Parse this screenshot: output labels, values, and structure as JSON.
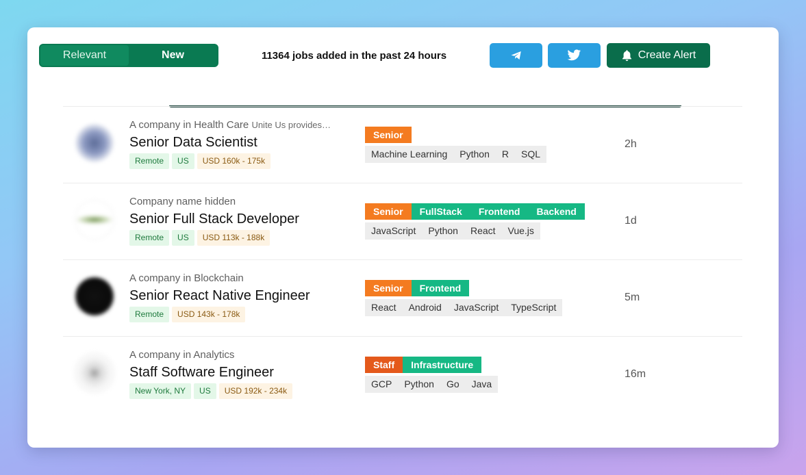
{
  "toolbar": {
    "sort_options": [
      "Relevant",
      "New"
    ],
    "active_sort": "Relevant",
    "headline": "11364 jobs added in the past 24 hours",
    "telegram_icon": "telegram-icon",
    "twitter_icon": "twitter-icon",
    "create_alert_label": "Create Alert"
  },
  "colors": {
    "primary_green": "#0a7a52",
    "social_blue": "#2a9fe0",
    "label_orange": "#f47b20",
    "label_teal": "#16b884"
  },
  "jobs": [
    {
      "company": "A company in Health Care",
      "company_desc": "Unite Us provides…",
      "title": "Senior Data Scientist",
      "location": "Remote",
      "country": "US",
      "salary": "USD 160k - 175k",
      "labels": [
        "Senior"
      ],
      "skills": [
        "Machine Learning",
        "Python",
        "R",
        "SQL"
      ],
      "age": "2h"
    },
    {
      "company": "Company name hidden",
      "company_desc": "",
      "title": "Senior Full Stack Developer",
      "location": "Remote",
      "country": "US",
      "salary": "USD 113k - 188k",
      "labels": [
        "Senior",
        "FullStack",
        "Frontend",
        "Backend"
      ],
      "skills": [
        "JavaScript",
        "Python",
        "React",
        "Vue.js"
      ],
      "age": "1d"
    },
    {
      "company": "A company in Blockchain",
      "company_desc": "",
      "title": "Senior React Native Engineer",
      "location": "Remote",
      "country": "",
      "salary": "USD 143k - 178k",
      "labels": [
        "Senior",
        "Frontend"
      ],
      "skills": [
        "React",
        "Android",
        "JavaScript",
        "TypeScript"
      ],
      "age": "5m"
    },
    {
      "company": "A company in Analytics",
      "company_desc": "",
      "title": "Staff Software Engineer",
      "location": "New York, NY",
      "country": "US",
      "salary": "USD 192k - 234k",
      "labels": [
        "Staff",
        "Infrastructure"
      ],
      "skills": [
        "GCP",
        "Python",
        "Go",
        "Java"
      ],
      "age": "16m"
    }
  ]
}
